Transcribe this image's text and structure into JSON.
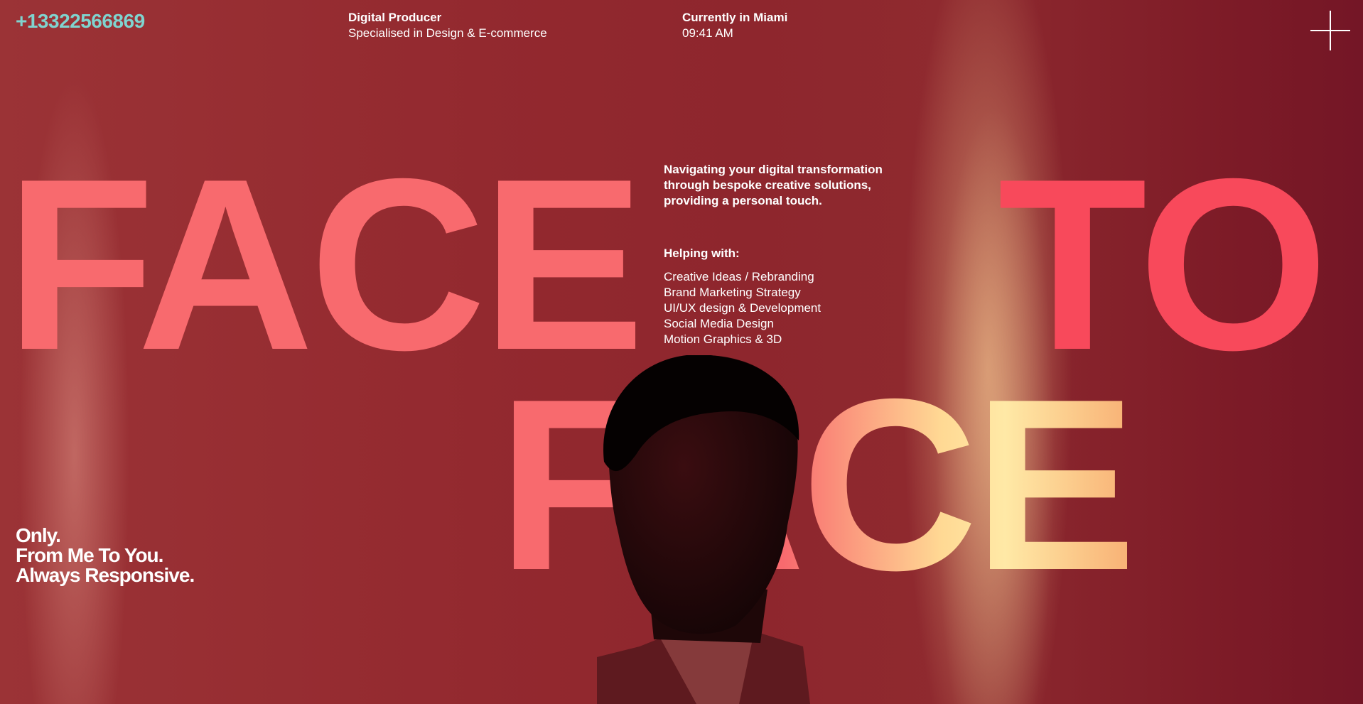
{
  "header": {
    "phone": "+13322566869",
    "role": {
      "title": "Digital Producer",
      "subtitle": "Specialised in Design & E-commerce"
    },
    "location": {
      "title": "Currently in Miami",
      "time": "09:41 AM"
    },
    "menu_icon": "plus-icon"
  },
  "hero": {
    "word1": "FACE",
    "word2": "TO",
    "word3": "FACE"
  },
  "intro": {
    "text": "Navigating your digital transformation through bespoke creative solutions, providing a personal touch."
  },
  "helping": {
    "heading": "Helping with:",
    "items": [
      "Creative Ideas / Rebranding",
      "Brand Marketing Strategy",
      "UI/UX design & Development",
      "Social Media Design",
      "Motion Graphics & 3D"
    ]
  },
  "tagline": {
    "line1": "Only.",
    "line2": "From Me To You.",
    "line3": "Always Responsive."
  },
  "colors": {
    "background": "#8f2a30",
    "phone_accent": "#7fd4cf",
    "hero_text": "#f86a6e",
    "hero_highlight": "#ffe9a6"
  }
}
